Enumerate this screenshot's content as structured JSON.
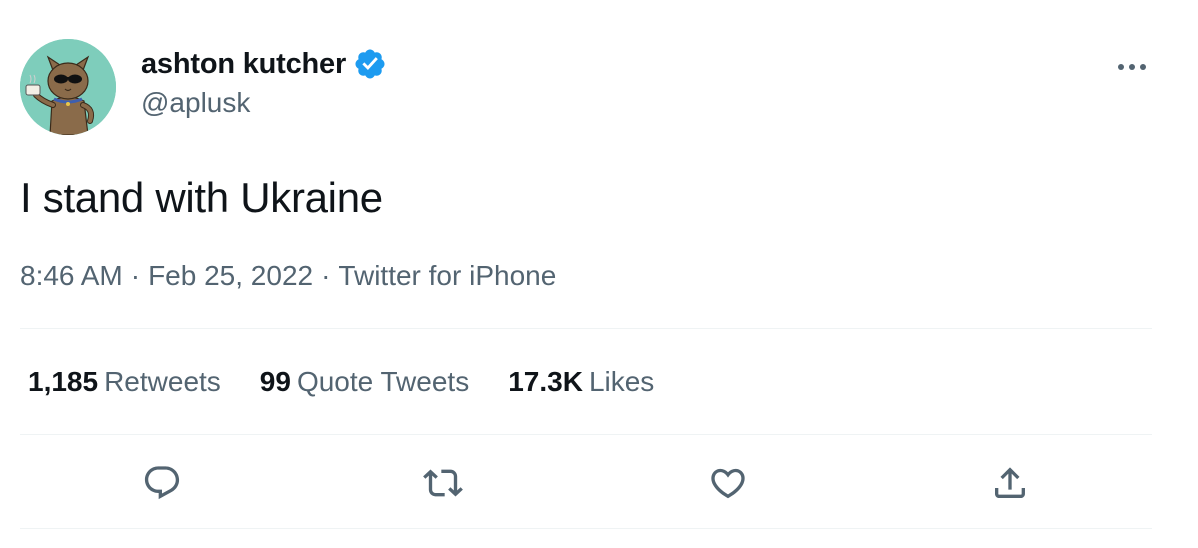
{
  "author": {
    "display_name": "ashton kutcher",
    "handle": "@aplusk",
    "verified": true
  },
  "tweet": {
    "text": "I stand with Ukraine"
  },
  "meta": {
    "time": "8:46 AM",
    "date": "Feb 25, 2022",
    "source": "Twitter for iPhone",
    "separator": "·"
  },
  "stats": {
    "retweets_count": "1,185",
    "retweets_label": "Retweets",
    "quote_tweets_count": "99",
    "quote_tweets_label": "Quote Tweets",
    "likes_count": "17.3K",
    "likes_label": "Likes"
  },
  "icons": {
    "verified": "verified-badge-icon",
    "more": "more-dots-icon",
    "reply": "reply-icon",
    "retweet": "retweet-icon",
    "like": "heart-icon",
    "share": "share-icon"
  },
  "colors": {
    "text_primary": "#0f1419",
    "text_secondary": "#536471",
    "verified_blue": "#1d9bf0",
    "divider": "#eff3f4",
    "avatar_bg": "#7ecdbb"
  }
}
